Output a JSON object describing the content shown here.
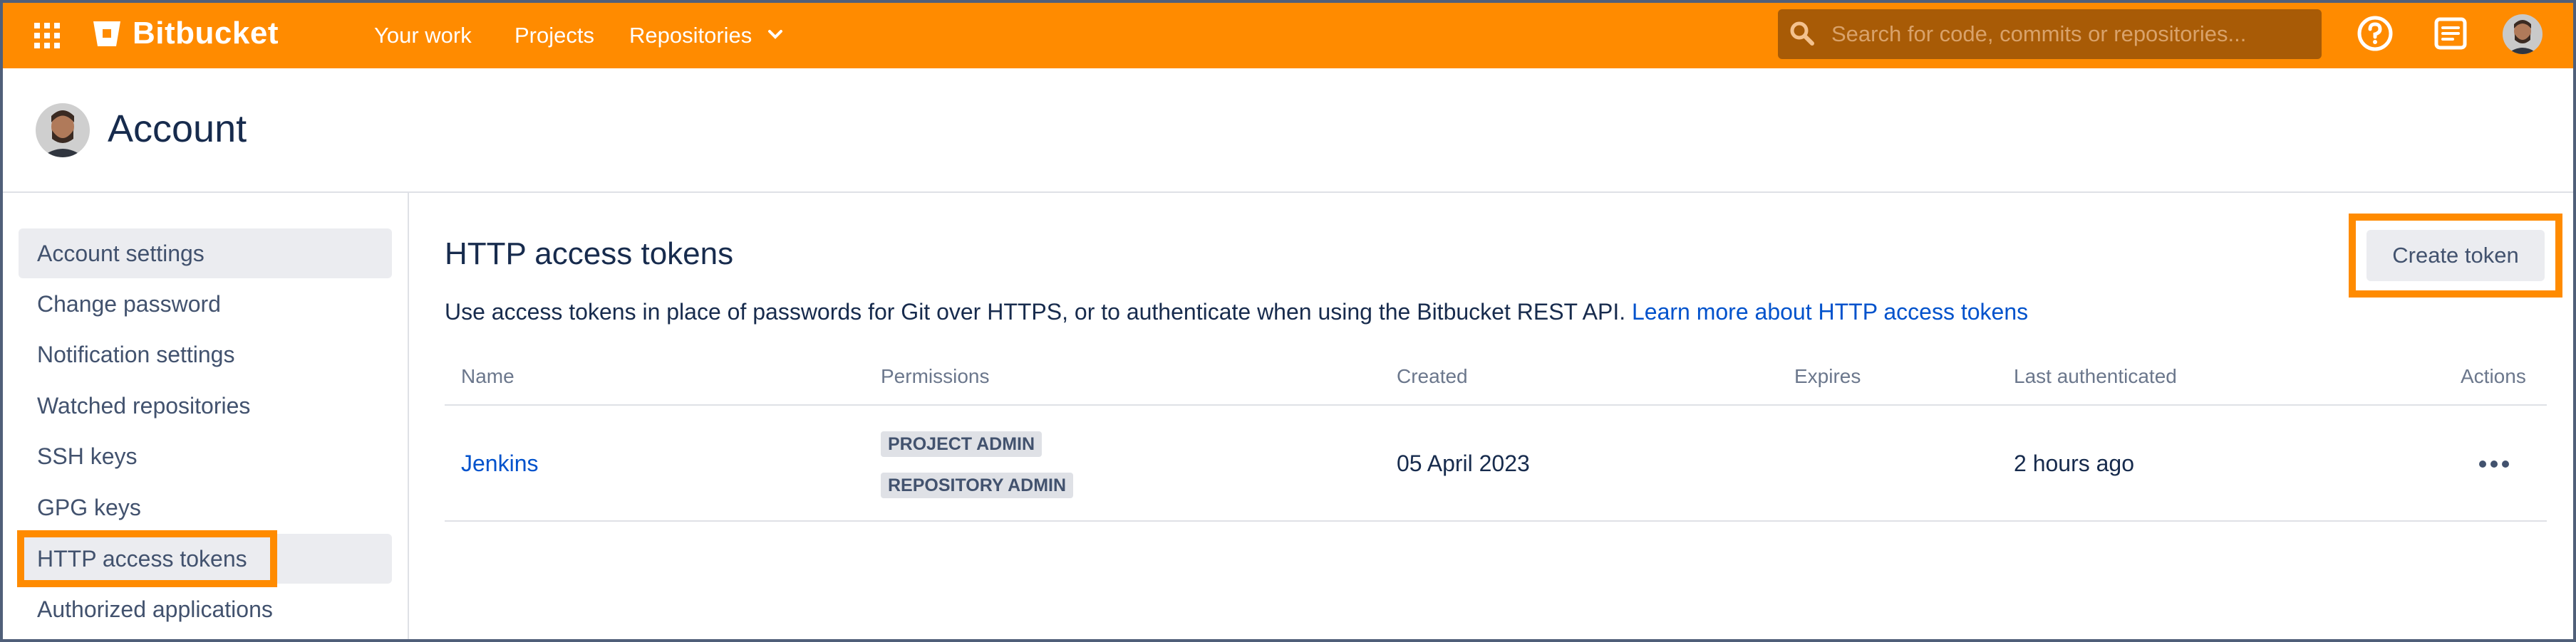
{
  "nav": {
    "brand": "Bitbucket",
    "links": {
      "your_work": "Your work",
      "projects": "Projects",
      "repositories": "Repositories"
    },
    "search_placeholder": "Search for code, commits or repositories...",
    "icons": [
      "apps-grid-icon",
      "bitbucket-logo-icon",
      "chevron-down-icon",
      "search-icon",
      "help-icon",
      "notes-icon",
      "avatar"
    ],
    "accent_color": "#ff8b00"
  },
  "header": {
    "title": "Account"
  },
  "sidebar": {
    "items": [
      {
        "label": "Account settings",
        "selected": true
      },
      {
        "label": "Change password",
        "selected": false
      },
      {
        "label": "Notification settings",
        "selected": false
      },
      {
        "label": "Watched repositories",
        "selected": false
      },
      {
        "label": "SSH keys",
        "selected": false
      },
      {
        "label": "GPG keys",
        "selected": false
      },
      {
        "label": "HTTP access tokens",
        "selected": true
      },
      {
        "label": "Authorized applications",
        "selected": false
      }
    ]
  },
  "main": {
    "title": "HTTP access tokens",
    "create_button": "Create token",
    "description": "Use access tokens in place of passwords for Git over HTTPS, or to authenticate when using the Bitbucket REST API.",
    "learn_more": "Learn more about HTTP access tokens",
    "columns": {
      "name": "Name",
      "permissions": "Permissions",
      "created": "Created",
      "expires": "Expires",
      "last_authenticated": "Last authenticated",
      "actions": "Actions"
    },
    "rows": [
      {
        "name": "Jenkins",
        "permissions": [
          "PROJECT ADMIN",
          "REPOSITORY ADMIN"
        ],
        "created": "05 April 2023",
        "expires": "",
        "last_authenticated": "2 hours ago"
      }
    ]
  }
}
